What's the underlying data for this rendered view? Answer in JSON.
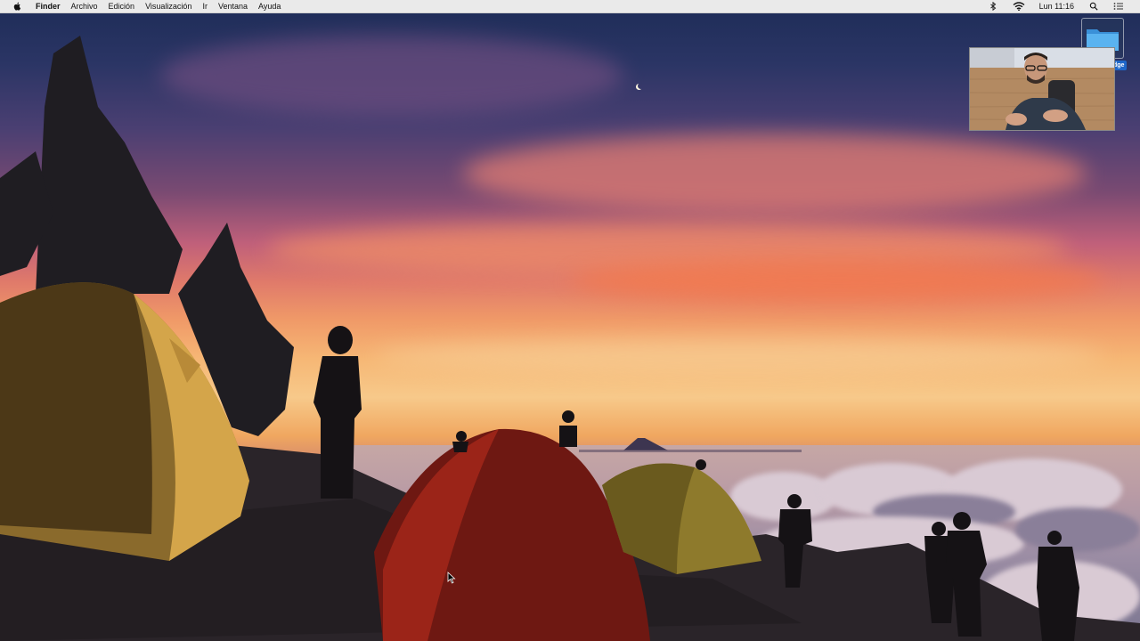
{
  "menubar": {
    "apple_icon": "apple-logo-icon",
    "app_name": "Finder",
    "menus": [
      "Archivo",
      "Edición",
      "Visualización",
      "Ir",
      "Ventana",
      "Ayuda"
    ],
    "status": {
      "extra_icon": "bluetooth-icon",
      "wifi_icon": "wifi-icon",
      "clock": "Lun 11:16",
      "search_icon": "spotlight-search-icon",
      "notifications_icon": "notification-center-icon"
    }
  },
  "desktop": {
    "folder_icon": "folder-icon",
    "folder_label": "dge"
  },
  "colors": {
    "menubar_bg": "#eaeaea",
    "folder_blue": "#4aa3e8",
    "label_blue": "#1f67c9"
  }
}
